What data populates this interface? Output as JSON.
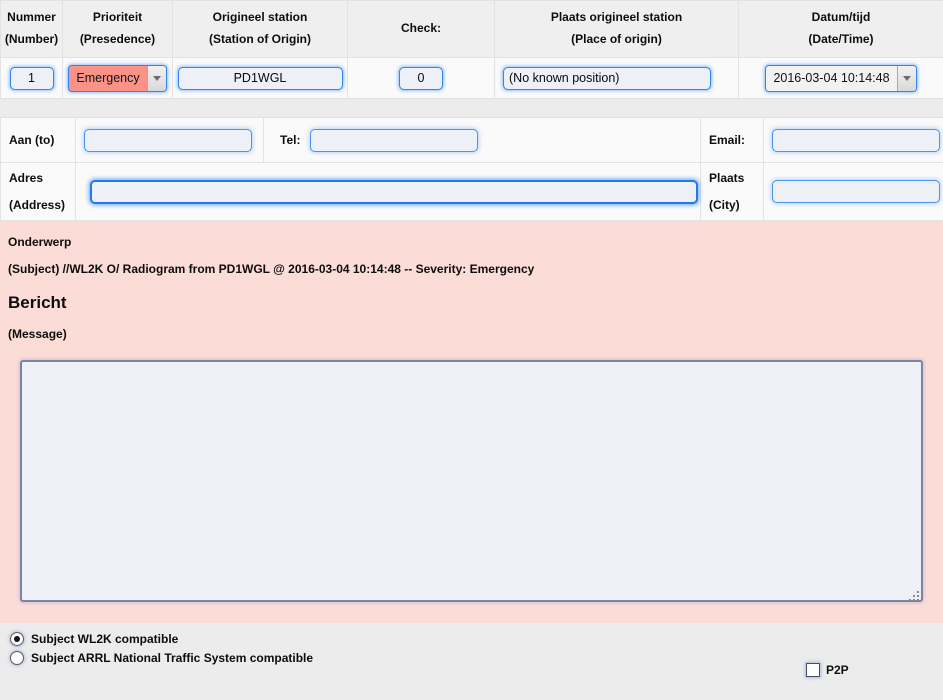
{
  "top_table": {
    "headers": [
      {
        "line1": "Nummer",
        "line2": "(Number)"
      },
      {
        "line1": "Prioriteit",
        "line2": "(Presedence)"
      },
      {
        "line1": "Origineel station",
        "line2": "(Station of Origin)"
      },
      {
        "line1": "Check:",
        "line2": ""
      },
      {
        "line1": "Plaats origineel station",
        "line2": "(Place of origin)"
      },
      {
        "line1": "Datum/tijd",
        "line2": "(Date/Time)"
      }
    ],
    "number_value": "1",
    "priority_value": "Emergency",
    "priority_color": "#fa9288",
    "station_value": "PD1WGL",
    "check_value": "0",
    "place_value": "(No known position)",
    "datetime_value": "2016-03-04 10:14:48"
  },
  "address_table": {
    "to_label": "Aan (to)",
    "to_value": "",
    "tel_label": "Tel:",
    "tel_value": "",
    "email_label": "Email:",
    "email_value": "",
    "address_label_l1": "Adres",
    "address_label_l2": "(Address)",
    "address_value": "",
    "city_label_l1": "Plaats",
    "city_label_l2": "(City)",
    "city_value": ""
  },
  "message": {
    "subject_heading": "Onderwerp",
    "subject_text": "(Subject) //WL2K O/ Radiogram from PD1WGL @ 2016-03-04 10:14:48 -- Severity: Emergency",
    "body_heading": "Bericht",
    "body_sublabel": "(Message)",
    "body_value": "",
    "background_color": "#fcdcd7"
  },
  "footer": {
    "options": [
      {
        "label": "Subject WL2K compatible",
        "selected": true
      },
      {
        "label": "Subject ARRL National Traffic System compatible",
        "selected": false
      }
    ],
    "p2p_label": "P2P",
    "p2p_checked": false
  }
}
